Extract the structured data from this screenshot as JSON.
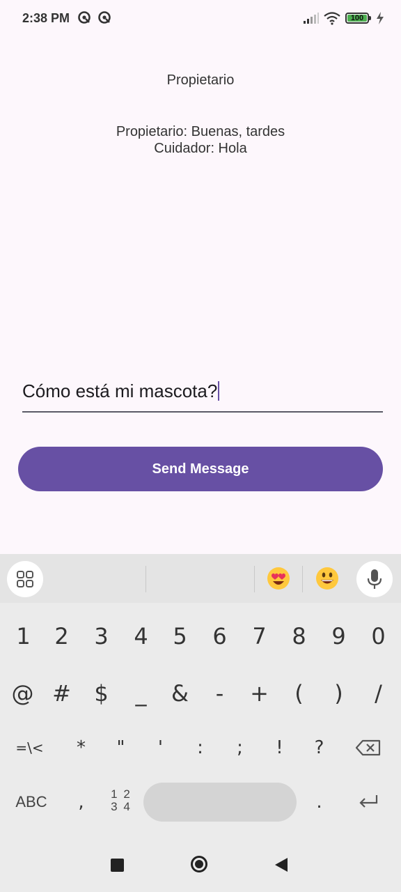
{
  "status_bar": {
    "time": "2:38 PM",
    "battery": "100",
    "battery_level": 1.0,
    "icons": [
      "notification-icon",
      "notification-icon",
      "signal-icon",
      "wifi-icon",
      "battery-icon",
      "charging-icon"
    ]
  },
  "screen": {
    "role_title": "Propietario",
    "messages": [
      "Propietario: Buenas, tardes",
      "Cuidador: Hola"
    ],
    "input_value": "Cómo está mi mascota?",
    "send_label": "Send Message"
  },
  "keyboard": {
    "toolbar_icons": [
      "apps-grid-icon",
      "heart-eyes-emoji-icon",
      "smiley-emoji-icon",
      "mic-icon"
    ],
    "row1": [
      "1",
      "2",
      "3",
      "4",
      "5",
      "6",
      "7",
      "8",
      "9",
      "0"
    ],
    "row2": [
      "@",
      "#",
      "$",
      "_",
      "&",
      "-",
      "+",
      "(",
      ")",
      "/"
    ],
    "row3": [
      "=\\<",
      "*",
      "\"",
      "'",
      ":",
      ";",
      "!",
      "?"
    ],
    "row4": {
      "abc": "ABC",
      "comma": ",",
      "num_top": "1 2",
      "num_bottom": "3 4",
      "period": "."
    }
  },
  "nav_bar": {
    "icons": [
      "recents-icon",
      "home-icon",
      "back-icon"
    ]
  },
  "colors": {
    "accent": "#6750a4",
    "background": "#fdf7fc",
    "keyboard": "#ebebeb"
  }
}
